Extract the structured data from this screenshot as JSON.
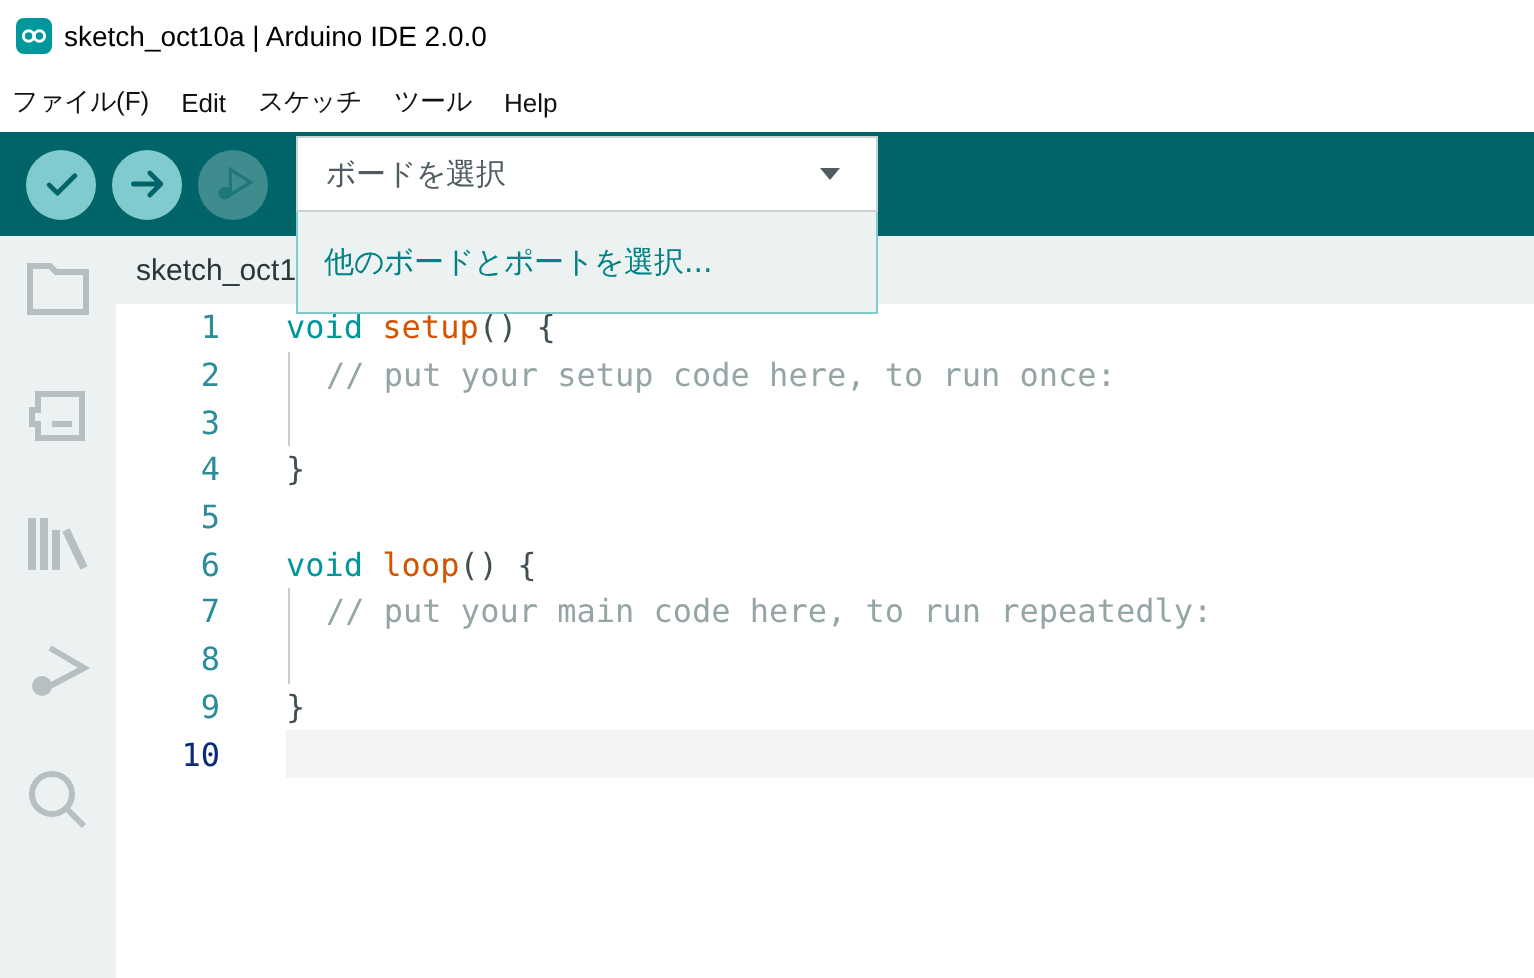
{
  "window": {
    "title": "sketch_oct10a | Arduino IDE 2.0.0"
  },
  "menu": [
    "ファイル(F)",
    "Edit",
    "スケッチ",
    "ツール",
    "Help"
  ],
  "toolbar": {
    "buttons": [
      {
        "kind": "verify",
        "disabled": false
      },
      {
        "kind": "upload",
        "disabled": false
      },
      {
        "kind": "debug",
        "disabled": true
      }
    ],
    "board_select": {
      "value": "ボードを選択",
      "options": [
        "他のボードとポートを選択..."
      ]
    }
  },
  "sidebar": {
    "items": [
      {
        "kind": "folder"
      },
      {
        "kind": "board"
      },
      {
        "kind": "library"
      },
      {
        "kind": "debug"
      },
      {
        "kind": "search"
      }
    ]
  },
  "tabs": [
    {
      "label": "sketch_oct1"
    }
  ],
  "editor": {
    "lines": [
      {
        "number": "1",
        "current": false,
        "indent_guide": false,
        "tokens": [
          {
            "kind": "keyword",
            "text": "void "
          },
          {
            "kind": "function",
            "text": "setup"
          },
          {
            "kind": "punct",
            "text": "() {"
          }
        ]
      },
      {
        "number": "2",
        "current": false,
        "indent_guide": true,
        "tokens": [
          {
            "kind": "comment",
            "text": "// put your setup code here, to run once:"
          }
        ]
      },
      {
        "number": "3",
        "current": false,
        "indent_guide": true
      },
      {
        "number": "4",
        "current": false,
        "indent_guide": false,
        "tokens": [
          {
            "kind": "punct",
            "text": "}"
          }
        ]
      },
      {
        "number": "5",
        "current": false,
        "indent_guide": false
      },
      {
        "number": "6",
        "current": false,
        "indent_guide": false,
        "tokens": [
          {
            "kind": "keyword",
            "text": "void "
          },
          {
            "kind": "function",
            "text": "loop"
          },
          {
            "kind": "punct",
            "text": "() {"
          }
        ]
      },
      {
        "number": "7",
        "current": false,
        "indent_guide": true,
        "tokens": [
          {
            "kind": "comment",
            "text": "// put your main code here, to run repeatedly:"
          }
        ]
      },
      {
        "number": "8",
        "current": false,
        "indent_guide": true
      },
      {
        "number": "9",
        "current": false,
        "indent_guide": false,
        "tokens": [
          {
            "kind": "punct",
            "text": "}"
          }
        ]
      },
      {
        "number": "10",
        "current": true,
        "indent_guide": false
      }
    ]
  }
}
